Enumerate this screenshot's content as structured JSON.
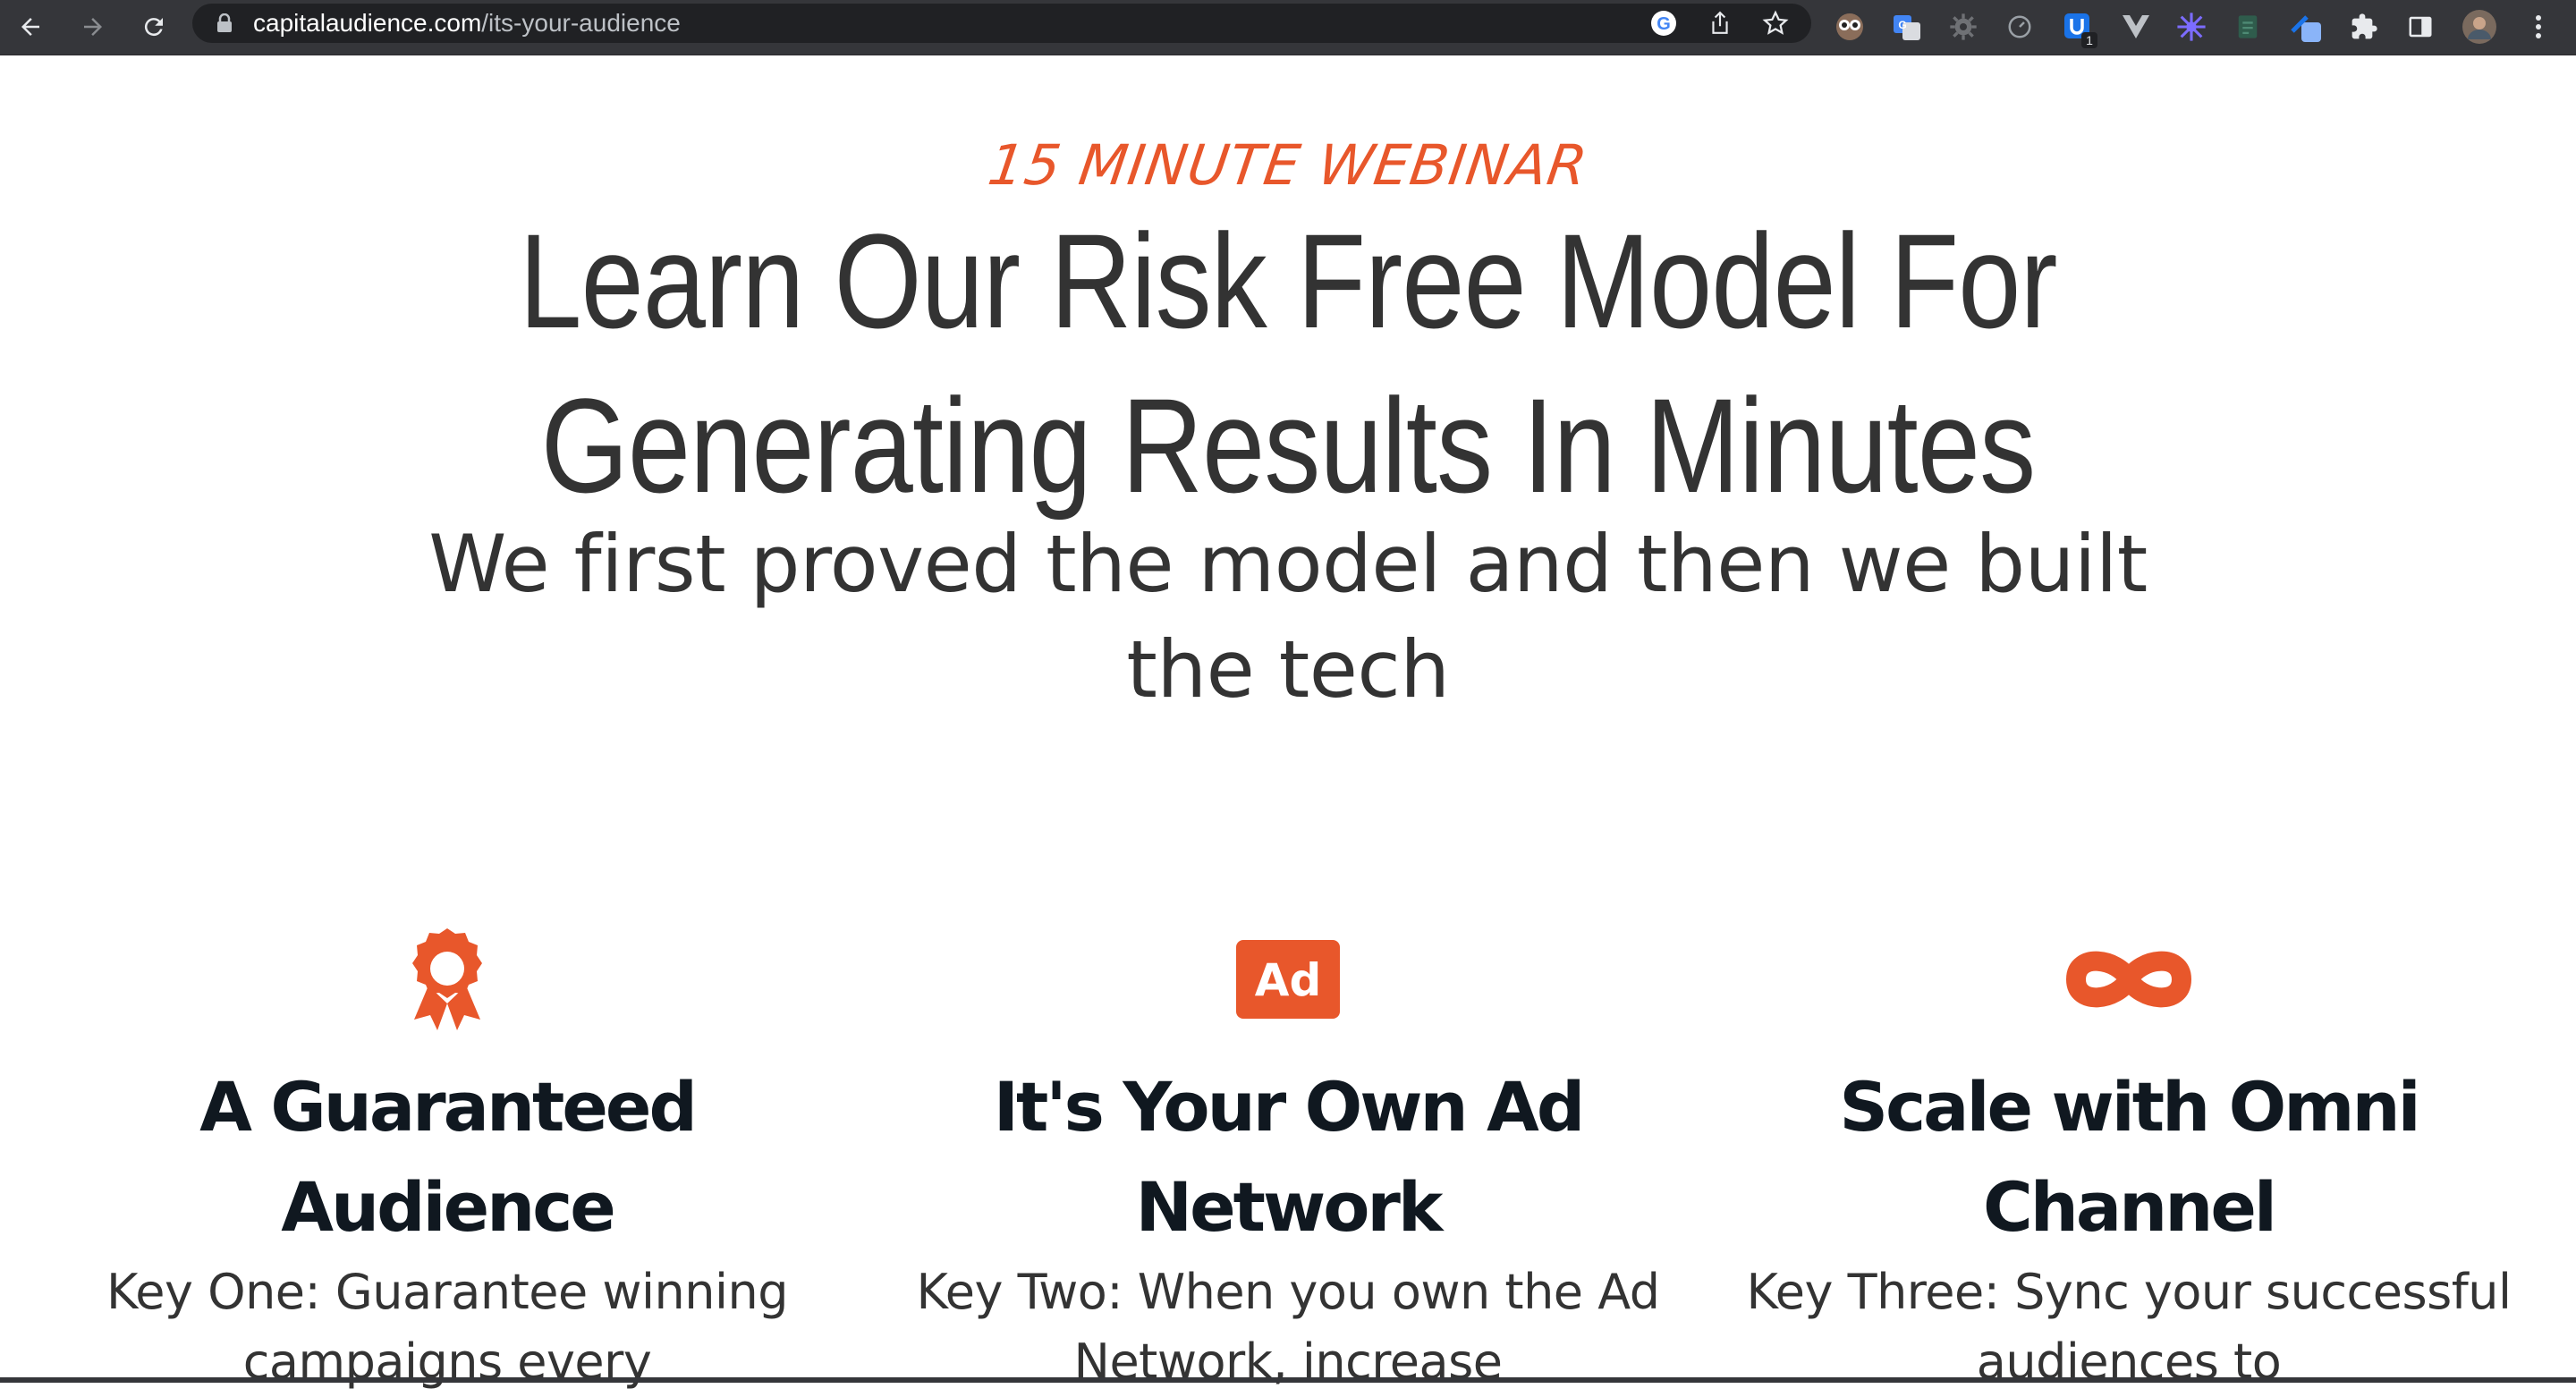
{
  "browser": {
    "url_host": "capitalaudience.com",
    "url_path": "/its-your-audience",
    "extension_badge": "1"
  },
  "hero": {
    "eyebrow": "15 MINUTE WEBINAR",
    "headline": "Learn Our Risk Free Model For Generating Results In Minutes",
    "subheadline": "We first proved the model and then we built the tech"
  },
  "features": [
    {
      "icon": "award-ribbon-icon",
      "title": "A Guaranteed Audience",
      "text": "Key One: Guarantee winning campaigns every"
    },
    {
      "icon": "ad-icon",
      "icon_text": "Ad",
      "title": "It's Your Own Ad Network",
      "text": "Key Two: When you own the Ad Network, increase"
    },
    {
      "icon": "infinity-icon",
      "title": "Scale with Omni Channel",
      "text": "Key Three: Sync your successful audiences to"
    }
  ],
  "colors": {
    "accent": "#e8572b",
    "headline": "#333333",
    "feature_title": "#101820",
    "chrome": "#35363a"
  }
}
